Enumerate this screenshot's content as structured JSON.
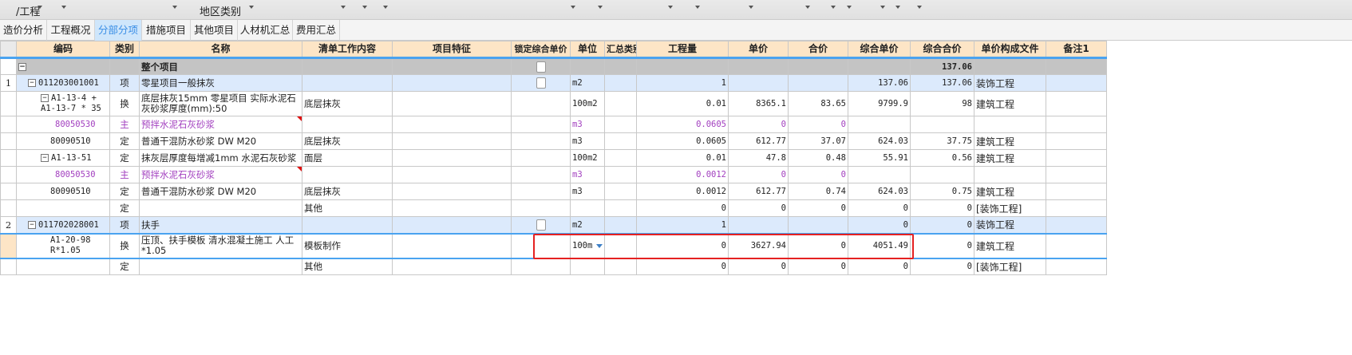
{
  "topbar": {
    "project_label": "/工程",
    "region_label": "地区类别"
  },
  "tabs": [
    "造价分析",
    "工程概况",
    "分部分项",
    "措施项目",
    "其他项目",
    "人材机汇总",
    "费用汇总"
  ],
  "active_tab": "分部分项",
  "columns": [
    "编码",
    "类别",
    "名称",
    "清单工作内容",
    "项目特征",
    "锁定综合单价",
    "单位",
    "汇总类别",
    "工程量",
    "单价",
    "合价",
    "综合单价",
    "综合合价",
    "单价构成文件",
    "备注1"
  ],
  "whole": {
    "name": "整个项目",
    "ctotal": "137.06"
  },
  "rows": [
    {
      "rn": "1",
      "code": "011203001001",
      "type": "项",
      "name": "零星项目一般抹灰",
      "content": "",
      "unit": "m2",
      "qty": "1",
      "price": "",
      "total": "",
      "cprice": "137.06",
      "ctotal": "137.06",
      "file": "装饰工程"
    },
    {
      "rn": "",
      "code": "A1-13-4 + A1-13-7 * 35",
      "type": "换",
      "name": "底层抹灰15mm 零星项目  实际水泥石灰砂浆厚度(mm):50",
      "content": "底层抹灰",
      "unit": "100m2",
      "qty": "0.01",
      "price": "8365.1",
      "total": "83.65",
      "cprice": "9799.9",
      "ctotal": "98",
      "file": "建筑工程"
    },
    {
      "rn": "",
      "code": "80050530",
      "type": "主",
      "name": "预拌水泥石灰砂浆",
      "content": "",
      "unit": "m3",
      "qty": "0.0605",
      "price": "0",
      "total": "0",
      "cprice": "",
      "ctotal": "",
      "file": ""
    },
    {
      "rn": "",
      "code": "80090510",
      "type": "定",
      "name": "普通干混防水砂浆 DW M20",
      "content": "底层抹灰",
      "unit": "m3",
      "qty": "0.0605",
      "price": "612.77",
      "total": "37.07",
      "cprice": "624.03",
      "ctotal": "37.75",
      "file": "建筑工程"
    },
    {
      "rn": "",
      "code": "A1-13-51",
      "type": "定",
      "name": "抹灰层厚度每增减1mm 水泥石灰砂浆",
      "content": "面层",
      "unit": "100m2",
      "qty": "0.01",
      "price": "47.8",
      "total": "0.48",
      "cprice": "55.91",
      "ctotal": "0.56",
      "file": "建筑工程"
    },
    {
      "rn": "",
      "code": "80050530",
      "type": "主",
      "name": "预拌水泥石灰砂浆",
      "content": "",
      "unit": "m3",
      "qty": "0.0012",
      "price": "0",
      "total": "0",
      "cprice": "",
      "ctotal": "",
      "file": ""
    },
    {
      "rn": "",
      "code": "80090510",
      "type": "定",
      "name": "普通干混防水砂浆 DW M20",
      "content": "底层抹灰",
      "unit": "m3",
      "qty": "0.0012",
      "price": "612.77",
      "total": "0.74",
      "cprice": "624.03",
      "ctotal": "0.75",
      "file": "建筑工程"
    },
    {
      "rn": "",
      "code": "",
      "type": "定",
      "name": "",
      "content": "其他",
      "unit": "",
      "qty": "0",
      "price": "0",
      "total": "0",
      "cprice": "0",
      "ctotal": "0",
      "file": "[装饰工程]"
    },
    {
      "rn": "2",
      "code": "011702028001",
      "type": "项",
      "name": "扶手",
      "content": "",
      "unit": "m2",
      "qty": "1",
      "price": "",
      "total": "",
      "cprice": "0",
      "ctotal": "0",
      "file": "装饰工程"
    },
    {
      "rn": "",
      "code": "A1-20-98 R*1.05",
      "type": "换",
      "name": "压顶、扶手模板  清水混凝土施工 人工*1.05",
      "content": "模板制作",
      "unit": "100m",
      "qty": "0",
      "price": "3627.94",
      "total": "0",
      "cprice": "4051.49",
      "ctotal": "0",
      "file": "建筑工程"
    },
    {
      "rn": "",
      "code": "",
      "type": "定",
      "name": "",
      "content": "其他",
      "unit": "",
      "qty": "0",
      "price": "0",
      "total": "0",
      "cprice": "0",
      "ctotal": "0",
      "file": "[装饰工程]"
    }
  ]
}
